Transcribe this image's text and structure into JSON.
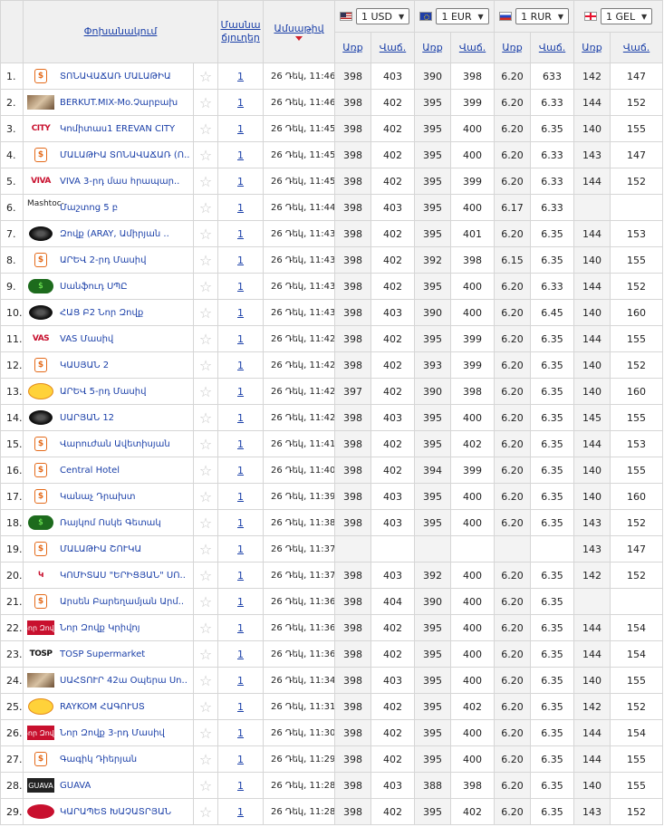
{
  "header": {
    "bank_col": "Փոխանակում",
    "branch_col_line1": "Մասնա",
    "branch_col_line2": "ճյուղեր",
    "date_col": "Ամսաթիվ",
    "buy": "Առք",
    "sell": "Վաճ."
  },
  "currencies": [
    {
      "code": "USD",
      "label": "1 USD",
      "flag": "us-flag-icon"
    },
    {
      "code": "EUR",
      "label": "1 EUR",
      "flag": "eu-flag-icon"
    },
    {
      "code": "RUR",
      "label": "1 RUR",
      "flag": "ru-flag-icon"
    },
    {
      "code": "GEL",
      "label": "1 GEL",
      "flag": "ge-flag-icon"
    }
  ],
  "rows": [
    {
      "n": "1.",
      "logo": "hex",
      "logo_text": "",
      "name": "ՏՈՆԱՎԱՃԱՌ ՄԱԼԱԹԻԱ",
      "branches": "1",
      "date": "26 Դեկ, 11:46",
      "usd_buy": "398",
      "usd_sell": "403",
      "eur_buy": "390",
      "eur_sell": "398",
      "rur_buy": "6.20",
      "rur_sell": "633",
      "gel_buy": "142",
      "gel_sell": "147"
    },
    {
      "n": "2.",
      "logo": "img",
      "logo_text": "",
      "name": "BERKUT.MIX-Mo.Չարբախ",
      "branches": "1",
      "date": "26 Դեկ, 11:46",
      "usd_buy": "398",
      "usd_sell": "402",
      "eur_buy": "395",
      "eur_sell": "399",
      "rur_buy": "6.20",
      "rur_sell": "6.33",
      "gel_buy": "144",
      "gel_sell": "152"
    },
    {
      "n": "3.",
      "logo": "text",
      "logo_text": "CITY",
      "name": "Կոմիտաս1 EREVAN CITY",
      "branches": "1",
      "date": "26 Դեկ, 11:45",
      "usd_buy": "398",
      "usd_sell": "402",
      "eur_buy": "395",
      "eur_sell": "400",
      "rur_buy": "6.20",
      "rur_sell": "6.35",
      "gel_buy": "140",
      "gel_sell": "155"
    },
    {
      "n": "4.",
      "logo": "hex",
      "logo_text": "",
      "name": "ՄԱԼԱԹԻԱ ՏՈՆԱՎԱՃԱՌ (Ո..",
      "branches": "1",
      "date": "26 Դեկ, 11:45",
      "usd_buy": "398",
      "usd_sell": "402",
      "eur_buy": "395",
      "eur_sell": "400",
      "rur_buy": "6.20",
      "rur_sell": "6.33",
      "gel_buy": "143",
      "gel_sell": "147"
    },
    {
      "n": "5.",
      "logo": "text",
      "logo_text": "VIVA",
      "name": "VIVA 3-րդ մաս hրապար..",
      "branches": "1",
      "date": "26 Դեկ, 11:45",
      "usd_buy": "398",
      "usd_sell": "402",
      "eur_buy": "395",
      "eur_sell": "399",
      "rur_buy": "6.20",
      "rur_sell": "6.33",
      "gel_buy": "144",
      "gel_sell": "152"
    },
    {
      "n": "6.",
      "logo": "broken",
      "logo_text": "Mashtoc-",
      "name": "Մաշտոց 5 բ",
      "branches": "1",
      "date": "26 Դեկ, 11:44",
      "usd_buy": "398",
      "usd_sell": "403",
      "eur_buy": "395",
      "eur_sell": "400",
      "rur_buy": "6.17",
      "rur_sell": "6.33",
      "gel_buy": "",
      "gel_sell": ""
    },
    {
      "n": "7.",
      "logo": "disc",
      "logo_text": "",
      "name": "Զովք (ARAY, Ամիրյան ..",
      "branches": "1",
      "date": "26 Դեկ, 11:43",
      "usd_buy": "398",
      "usd_sell": "402",
      "eur_buy": "395",
      "eur_sell": "401",
      "rur_buy": "6.20",
      "rur_sell": "6.35",
      "gel_buy": "144",
      "gel_sell": "153"
    },
    {
      "n": "8.",
      "logo": "hex",
      "logo_text": "",
      "name": "ԱՐԵՎ 2-րդ Մասիվ",
      "branches": "1",
      "date": "26 Դեկ, 11:43",
      "usd_buy": "398",
      "usd_sell": "402",
      "eur_buy": "392",
      "eur_sell": "398",
      "rur_buy": "6.15",
      "rur_sell": "6.35",
      "gel_buy": "140",
      "gel_sell": "155"
    },
    {
      "n": "9.",
      "logo": "green",
      "logo_text": "$",
      "name": "Սանֆուդ ՍՊԸ",
      "branches": "1",
      "date": "26 Դեկ, 11:43",
      "usd_buy": "398",
      "usd_sell": "402",
      "eur_buy": "395",
      "eur_sell": "400",
      "rur_buy": "6.20",
      "rur_sell": "6.33",
      "gel_buy": "144",
      "gel_sell": "152"
    },
    {
      "n": "10.",
      "logo": "disc",
      "logo_text": "",
      "name": "ՀԱՑ Բ2 Նոր Զովք",
      "branches": "1",
      "date": "26 Դեկ, 11:43",
      "usd_buy": "398",
      "usd_sell": "403",
      "eur_buy": "390",
      "eur_sell": "400",
      "rur_buy": "6.20",
      "rur_sell": "6.45",
      "gel_buy": "140",
      "gel_sell": "160"
    },
    {
      "n": "11.",
      "logo": "text",
      "logo_text": "VAS",
      "name": "VAS Մասիվ",
      "branches": "1",
      "date": "26 Դեկ, 11:42",
      "usd_buy": "398",
      "usd_sell": "402",
      "eur_buy": "395",
      "eur_sell": "399",
      "rur_buy": "6.20",
      "rur_sell": "6.35",
      "gel_buy": "144",
      "gel_sell": "155"
    },
    {
      "n": "12.",
      "logo": "hex",
      "logo_text": "",
      "name": "ԿԱՍՅԱՆ 2",
      "branches": "1",
      "date": "26 Դեկ, 11:42",
      "usd_buy": "398",
      "usd_sell": "402",
      "eur_buy": "393",
      "eur_sell": "399",
      "rur_buy": "6.20",
      "rur_sell": "6.35",
      "gel_buy": "140",
      "gel_sell": "152"
    },
    {
      "n": "13.",
      "logo": "yellow",
      "logo_text": "",
      "name": "ԱՐԵՎ 5-րդ Մասիվ",
      "branches": "1",
      "date": "26 Դեկ, 11:42",
      "usd_buy": "397",
      "usd_sell": "402",
      "eur_buy": "390",
      "eur_sell": "398",
      "rur_buy": "6.20",
      "rur_sell": "6.35",
      "gel_buy": "140",
      "gel_sell": "160"
    },
    {
      "n": "14.",
      "logo": "disc",
      "logo_text": "",
      "name": "ՍԱՐՅԱՆ 12",
      "branches": "1",
      "date": "26 Դեկ, 11:42",
      "usd_buy": "398",
      "usd_sell": "403",
      "eur_buy": "395",
      "eur_sell": "400",
      "rur_buy": "6.20",
      "rur_sell": "6.35",
      "gel_buy": "145",
      "gel_sell": "155"
    },
    {
      "n": "15.",
      "logo": "hex",
      "logo_text": "",
      "name": "Վարուժան Ավետիսյան",
      "branches": "1",
      "date": "26 Դեկ, 11:41",
      "usd_buy": "398",
      "usd_sell": "402",
      "eur_buy": "395",
      "eur_sell": "402",
      "rur_buy": "6.20",
      "rur_sell": "6.35",
      "gel_buy": "144",
      "gel_sell": "153"
    },
    {
      "n": "16.",
      "logo": "hex",
      "logo_text": "",
      "name": "Central Hotel",
      "branches": "1",
      "date": "26 Դեկ, 11:40",
      "usd_buy": "398",
      "usd_sell": "402",
      "eur_buy": "394",
      "eur_sell": "399",
      "rur_buy": "6.20",
      "rur_sell": "6.35",
      "gel_buy": "140",
      "gel_sell": "155"
    },
    {
      "n": "17.",
      "logo": "hex",
      "logo_text": "",
      "name": "Կանաչ Դրախտ",
      "branches": "1",
      "date": "26 Դեկ, 11:39",
      "usd_buy": "398",
      "usd_sell": "403",
      "eur_buy": "395",
      "eur_sell": "400",
      "rur_buy": "6.20",
      "rur_sell": "6.35",
      "gel_buy": "140",
      "gel_sell": "160"
    },
    {
      "n": "18.",
      "logo": "green",
      "logo_text": "$",
      "name": "Ռայկոմ Ոսկե Գետակ",
      "branches": "1",
      "date": "26 Դեկ, 11:38",
      "usd_buy": "398",
      "usd_sell": "403",
      "eur_buy": "395",
      "eur_sell": "400",
      "rur_buy": "6.20",
      "rur_sell": "6.35",
      "gel_buy": "143",
      "gel_sell": "152"
    },
    {
      "n": "19.",
      "logo": "hex",
      "logo_text": "",
      "name": "ՄԱԼԱԹԻԱ ՇՈՒԿԱ",
      "branches": "1",
      "date": "26 Դեկ, 11:37",
      "usd_buy": "",
      "usd_sell": "",
      "eur_buy": "",
      "eur_sell": "",
      "rur_buy": "",
      "rur_sell": "",
      "gel_buy": "143",
      "gel_sell": "147"
    },
    {
      "n": "20.",
      "logo": "text",
      "logo_text": "Կ",
      "name": "ԿՈՄԻՏԱՍ \"ԵՐԻՑՅԱՆ\" ՍՈ..",
      "branches": "1",
      "date": "26 Դեկ, 11:37",
      "usd_buy": "398",
      "usd_sell": "403",
      "eur_buy": "392",
      "eur_sell": "400",
      "rur_buy": "6.20",
      "rur_sell": "6.35",
      "gel_buy": "142",
      "gel_sell": "152"
    },
    {
      "n": "21.",
      "logo": "hex",
      "logo_text": "",
      "name": "Արսեն Բարեղամյան Արմ..",
      "branches": "1",
      "date": "26 Դեկ, 11:36",
      "usd_buy": "398",
      "usd_sell": "404",
      "eur_buy": "390",
      "eur_sell": "400",
      "rur_buy": "6.20",
      "rur_sell": "6.35",
      "gel_buy": "",
      "gel_sell": ""
    },
    {
      "n": "22.",
      "logo": "redbox",
      "logo_text": "Նոր Զովք",
      "name": "Նոր Զովք Կրիվոյ",
      "branches": "1",
      "date": "26 Դեկ, 11:36",
      "usd_buy": "398",
      "usd_sell": "402",
      "eur_buy": "395",
      "eur_sell": "400",
      "rur_buy": "6.20",
      "rur_sell": "6.35",
      "gel_buy": "144",
      "gel_sell": "154"
    },
    {
      "n": "23.",
      "logo": "tosp",
      "logo_text": "TOSP",
      "name": "TOSP Supermarket",
      "branches": "1",
      "date": "26 Դեկ, 11:36",
      "usd_buy": "398",
      "usd_sell": "402",
      "eur_buy": "395",
      "eur_sell": "400",
      "rur_buy": "6.20",
      "rur_sell": "6.35",
      "gel_buy": "144",
      "gel_sell": "154"
    },
    {
      "n": "24.",
      "logo": "img",
      "logo_text": "",
      "name": "ՍԱՀՏՈՒՐ 42ա Օպերա Սո..",
      "branches": "1",
      "date": "26 Դեկ, 11:34",
      "usd_buy": "398",
      "usd_sell": "403",
      "eur_buy": "395",
      "eur_sell": "400",
      "rur_buy": "6.20",
      "rur_sell": "6.35",
      "gel_buy": "140",
      "gel_sell": "155"
    },
    {
      "n": "25.",
      "logo": "yellow",
      "logo_text": "",
      "name": "RAYKOM ՀԱԳՈՒՍՏ",
      "branches": "1",
      "date": "26 Դեկ, 11:31",
      "usd_buy": "398",
      "usd_sell": "402",
      "eur_buy": "395",
      "eur_sell": "402",
      "rur_buy": "6.20",
      "rur_sell": "6.35",
      "gel_buy": "142",
      "gel_sell": "152"
    },
    {
      "n": "26.",
      "logo": "redbox",
      "logo_text": "Նոր Զովք",
      "name": "Նոր Զովք 3-րդ Մասիվ",
      "branches": "1",
      "date": "26 Դեկ, 11:30",
      "usd_buy": "398",
      "usd_sell": "402",
      "eur_buy": "395",
      "eur_sell": "400",
      "rur_buy": "6.20",
      "rur_sell": "6.35",
      "gel_buy": "144",
      "gel_sell": "154"
    },
    {
      "n": "27.",
      "logo": "hex",
      "logo_text": "",
      "name": "Գագիկ Դիերյան",
      "branches": "1",
      "date": "26 Դեկ, 11:29",
      "usd_buy": "398",
      "usd_sell": "402",
      "eur_buy": "395",
      "eur_sell": "400",
      "rur_buy": "6.20",
      "rur_sell": "6.35",
      "gel_buy": "144",
      "gel_sell": "155"
    },
    {
      "n": "28.",
      "logo": "dark",
      "logo_text": "GUAVA",
      "name": "GUAVA",
      "branches": "1",
      "date": "26 Դեկ, 11:28",
      "usd_buy": "398",
      "usd_sell": "403",
      "eur_buy": "388",
      "eur_sell": "398",
      "rur_buy": "6.20",
      "rur_sell": "6.35",
      "gel_buy": "140",
      "gel_sell": "155"
    },
    {
      "n": "29.",
      "logo": "redoval",
      "logo_text": "",
      "name": "ԿԱՐԱՊԵՏ ԽԱՉԱՏՐՅԱՆ",
      "branches": "1",
      "date": "26 Դեկ, 11:28",
      "usd_buy": "398",
      "usd_sell": "402",
      "eur_buy": "395",
      "eur_sell": "402",
      "rur_buy": "6.20",
      "rur_sell": "6.35",
      "gel_buy": "143",
      "gel_sell": "152"
    }
  ]
}
